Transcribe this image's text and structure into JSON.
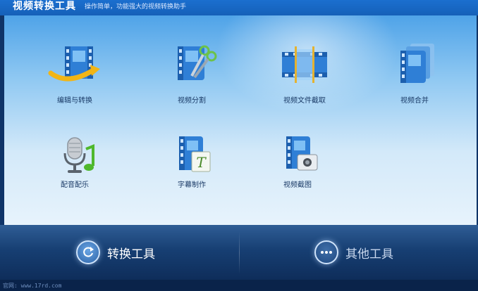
{
  "title_bar": {
    "title": "视频转换工具",
    "subtitle": "操作简单，功能强大的视频转换助手"
  },
  "tools": [
    {
      "label": "编辑与转换",
      "icon": "film-arrow-icon"
    },
    {
      "label": "视频分割",
      "icon": "film-scissors-icon"
    },
    {
      "label": "视频文件截取",
      "icon": "film-clip-icon"
    },
    {
      "label": "视频合并",
      "icon": "film-stack-icon"
    },
    {
      "label": "配音配乐",
      "icon": "microphone-music-icon"
    },
    {
      "label": "字幕制作",
      "icon": "film-subtitle-icon"
    },
    {
      "label": "视频截图",
      "icon": "film-camera-icon"
    }
  ],
  "bottom": {
    "convert_label": "转换工具",
    "other_label": "其他工具"
  },
  "status": {
    "text": "官网: www.17rd.com"
  },
  "colors": {
    "title_bar": "#1b6fcf",
    "film_blue": "#2f7fd6",
    "bottom_bar": "#173f73"
  }
}
